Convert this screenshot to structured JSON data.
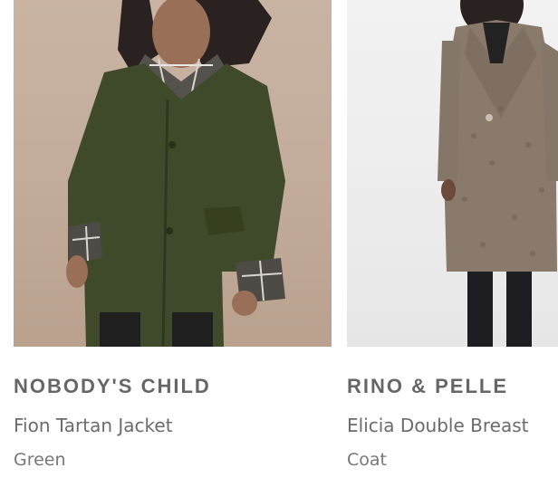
{
  "products": [
    {
      "brand": "NOBODY'S CHILD",
      "name": "Fion Tartan Jacket",
      "detail": "Green",
      "image_alt": "Woman wearing a green jacket with tartan collar and cuffs"
    },
    {
      "brand": "RINO & PELLE",
      "name": "Elicia Double Breast",
      "detail": "Coat",
      "image_alt": "Model wearing a long taupe teddy coat"
    }
  ],
  "colors": {
    "jacket": "#3f4a2a",
    "coat": "#8a7a6c",
    "text_brand": "#666666",
    "text_body": "#6b6b6b"
  }
}
